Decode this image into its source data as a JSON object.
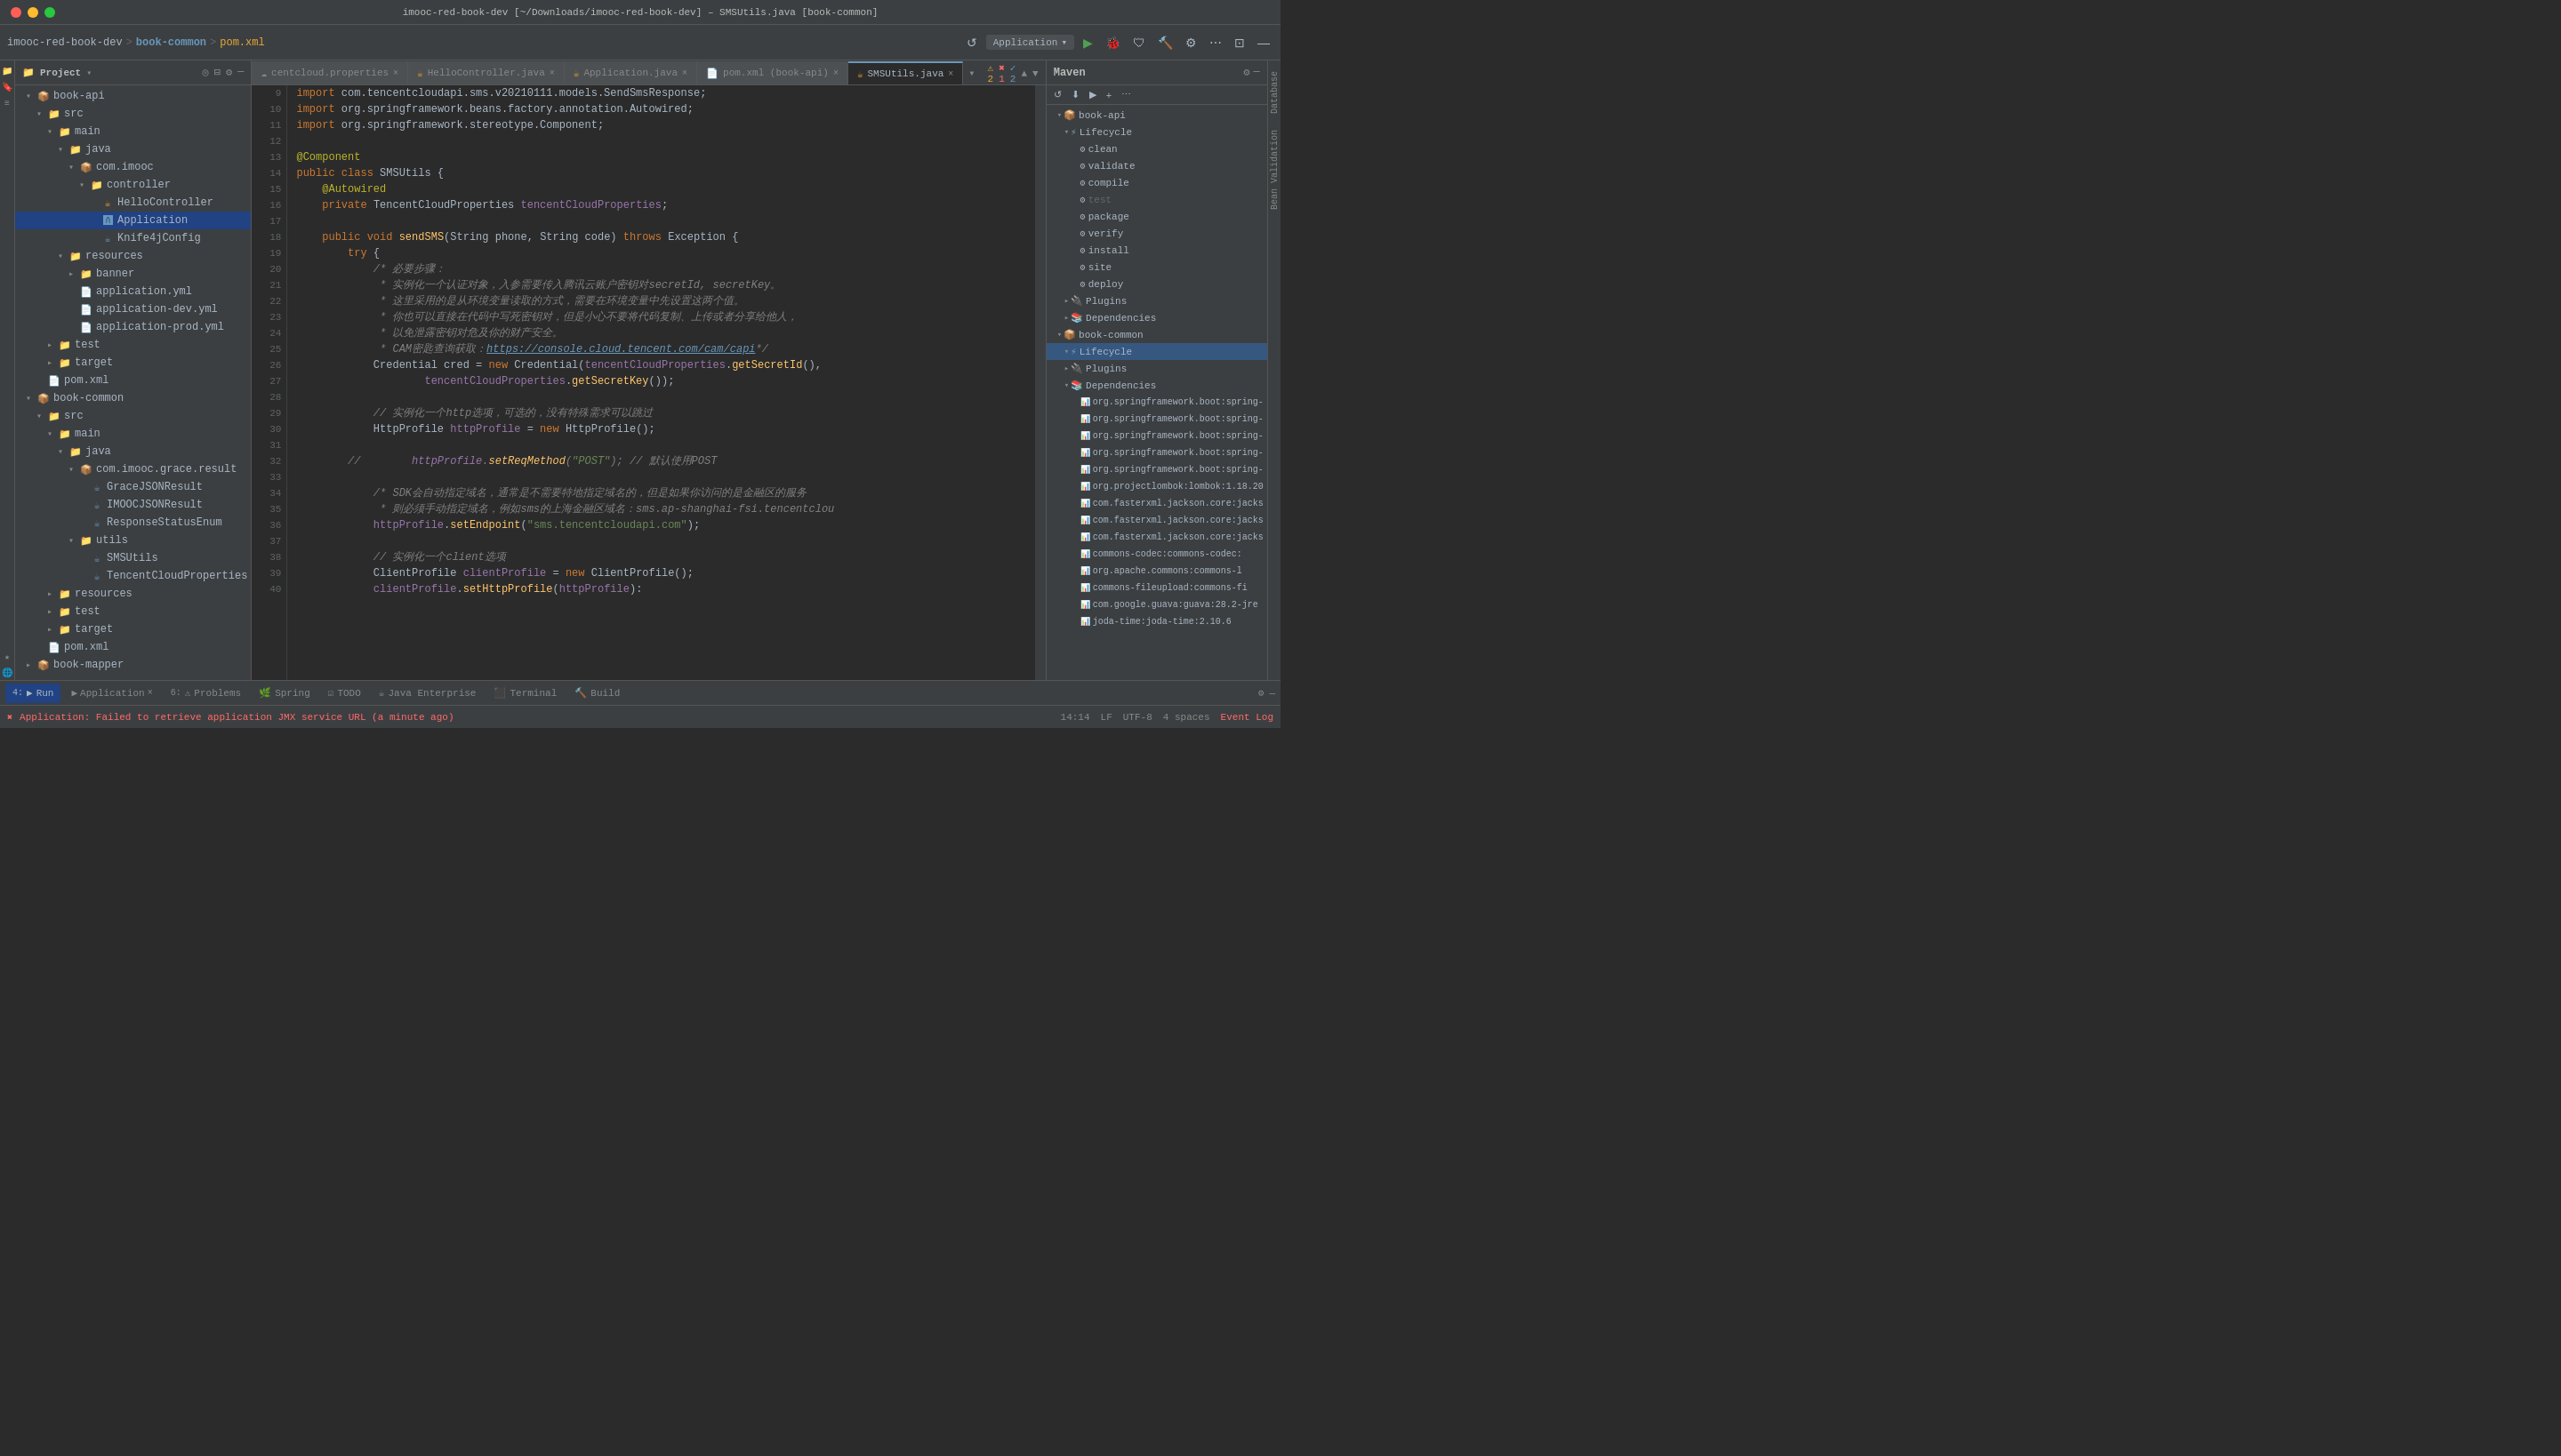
{
  "window": {
    "title": "imooc-red-book-dev [~/Downloads/imooc-red-book-dev] – SMSUtils.java [book-common]"
  },
  "breadcrumb": {
    "project": "imooc-red-book-dev",
    "sep1": ">",
    "module": "book-common",
    "sep2": ">",
    "file": "pom.xml"
  },
  "toolbar": {
    "run_config": "Application",
    "run_icon": "▶",
    "debug_icon": "🐛",
    "build_icon": "🔨",
    "refresh_icon": "↺",
    "settings_icon": "⚙",
    "run_green": "▶"
  },
  "project_panel": {
    "title": "Project",
    "items": [
      {
        "id": "book-api",
        "label": "book-api",
        "indent": 1,
        "type": "module",
        "expanded": true
      },
      {
        "id": "src1",
        "label": "src",
        "indent": 2,
        "type": "folder",
        "expanded": true
      },
      {
        "id": "main1",
        "label": "main",
        "indent": 3,
        "type": "folder",
        "expanded": true
      },
      {
        "id": "java1",
        "label": "java",
        "indent": 4,
        "type": "folder",
        "expanded": true
      },
      {
        "id": "comimooc1",
        "label": "com.imooc",
        "indent": 5,
        "type": "package",
        "expanded": true
      },
      {
        "id": "controller",
        "label": "controller",
        "indent": 6,
        "type": "folder",
        "expanded": true
      },
      {
        "id": "hellocontroller",
        "label": "HelloController",
        "indent": 7,
        "type": "java",
        "selected": false
      },
      {
        "id": "application",
        "label": "Application",
        "indent": 7,
        "type": "java",
        "selected": true
      },
      {
        "id": "knife4j",
        "label": "Knife4jConfig",
        "indent": 7,
        "type": "java",
        "selected": false
      },
      {
        "id": "resources1",
        "label": "resources",
        "indent": 4,
        "type": "folder",
        "expanded": true
      },
      {
        "id": "banner",
        "label": "banner",
        "indent": 5,
        "type": "folder",
        "expanded": false
      },
      {
        "id": "appyml",
        "label": "application.yml",
        "indent": 5,
        "type": "yaml"
      },
      {
        "id": "appdevyml",
        "label": "application-dev.yml",
        "indent": 5,
        "type": "yaml"
      },
      {
        "id": "appprodlyml",
        "label": "application-prod.yml",
        "indent": 5,
        "type": "yaml"
      },
      {
        "id": "test1",
        "label": "test",
        "indent": 3,
        "type": "folder",
        "expanded": false
      },
      {
        "id": "target1",
        "label": "target",
        "indent": 3,
        "type": "folder",
        "expanded": false
      },
      {
        "id": "pomxml1",
        "label": "pom.xml",
        "indent": 2,
        "type": "xml"
      },
      {
        "id": "book-common",
        "label": "book-common",
        "indent": 1,
        "type": "module",
        "expanded": true
      },
      {
        "id": "src2",
        "label": "src",
        "indent": 2,
        "type": "folder",
        "expanded": true
      },
      {
        "id": "main2",
        "label": "main",
        "indent": 3,
        "type": "folder",
        "expanded": true
      },
      {
        "id": "java2",
        "label": "java",
        "indent": 4,
        "type": "folder",
        "expanded": true
      },
      {
        "id": "comimoograce",
        "label": "com.imooc.grace.result",
        "indent": 5,
        "type": "package",
        "expanded": true
      },
      {
        "id": "gracejson",
        "label": "GraceJSONResult",
        "indent": 6,
        "type": "java"
      },
      {
        "id": "imoocjson",
        "label": "IMOOCJSONResult",
        "indent": 6,
        "type": "java"
      },
      {
        "id": "responsestatus",
        "label": "ResponseStatusEnum",
        "indent": 6,
        "type": "java"
      },
      {
        "id": "utils",
        "label": "utils",
        "indent": 5,
        "type": "folder",
        "expanded": true
      },
      {
        "id": "smsutils",
        "label": "SMSUtils",
        "indent": 6,
        "type": "java"
      },
      {
        "id": "tencentcloud",
        "label": "TencentCloudProperties",
        "indent": 6,
        "type": "java"
      },
      {
        "id": "resources2",
        "label": "resources",
        "indent": 3,
        "type": "folder",
        "expanded": false
      },
      {
        "id": "test2",
        "label": "test",
        "indent": 3,
        "type": "folder",
        "expanded": false
      },
      {
        "id": "target2",
        "label": "target",
        "indent": 3,
        "type": "folder",
        "expanded": false
      },
      {
        "id": "pomxml2",
        "label": "pom.xml",
        "indent": 2,
        "type": "xml"
      },
      {
        "id": "book-mapper",
        "label": "book-mapper",
        "indent": 1,
        "type": "module",
        "expanded": false
      }
    ]
  },
  "tabs": [
    {
      "id": "centcloud",
      "label": "centcloud.properties",
      "active": false,
      "icon": "☁"
    },
    {
      "id": "hellocontroller",
      "label": "HelloController.java",
      "active": false,
      "icon": "☕"
    },
    {
      "id": "applicationjava",
      "label": "Application.java",
      "active": false,
      "icon": "☕"
    },
    {
      "id": "pomapi",
      "label": "pom.xml (book-api)",
      "active": false,
      "icon": "📄"
    },
    {
      "id": "smsutils",
      "label": "SMSUtils.java",
      "active": true,
      "icon": "☕"
    }
  ],
  "editor": {
    "filename": "SMSUtils.java",
    "lines": [
      {
        "n": 9,
        "code": "import com.tencentcloudapi.sms.v20210111.models.SendSmsResponse;"
      },
      {
        "n": 10,
        "code": "import org.springframework.beans.factory.annotation.Autowired;"
      },
      {
        "n": 11,
        "code": "import org.springframework.stereotype.Component;"
      },
      {
        "n": 12,
        "code": ""
      },
      {
        "n": 13,
        "code": "@Component"
      },
      {
        "n": 14,
        "code": "public class SMSUtils {"
      },
      {
        "n": 15,
        "code": "    @Autowired"
      },
      {
        "n": 16,
        "code": "    private TencentCloudProperties tencentCloudProperties;"
      },
      {
        "n": 17,
        "code": ""
      },
      {
        "n": 18,
        "code": "    public void sendSMS(String phone, String code) throws Exception {"
      },
      {
        "n": 19,
        "code": "        try {"
      },
      {
        "n": 20,
        "code": "            /* 必要步骤："
      },
      {
        "n": 21,
        "code": "             * 实例化一个认证对象，入参需要传入腾讯云账户密钥对secretId, secretKey。"
      },
      {
        "n": 22,
        "code": "             * 这里采用的是从环境变量读取的方式，需要在环境变量中先设置这两个值。"
      },
      {
        "n": 23,
        "code": "             * 你也可以直接在代码中写死密钥对，但是小心不要将代码复制、上传或者分享给他人，"
      },
      {
        "n": 24,
        "code": "             * 以免泄露密钥对危及你的财产安全。"
      },
      {
        "n": 25,
        "code": "             * CAM密匙查询获取：https://console.cloud.tencent.com/cam/capi*/"
      },
      {
        "n": 26,
        "code": "            Credential cred = new Credential(tencentCloudProperties.getSecretId(),"
      },
      {
        "n": 27,
        "code": "                    tencentCloudProperties.getSecretKey());"
      },
      {
        "n": 28,
        "code": ""
      },
      {
        "n": 29,
        "code": "            // 实例化一个http选项，可选的，没有特殊需求可以跳过"
      },
      {
        "n": 30,
        "code": "            HttpProfile httpProfile = new HttpProfile();"
      },
      {
        "n": 31,
        "code": ""
      },
      {
        "n": 32,
        "code": "//            httpProfile.setReqMethod(\"POST\"); // 默认使用POST"
      },
      {
        "n": 33,
        "code": ""
      },
      {
        "n": 34,
        "code": "            /* SDK会自动指定域名，通常是不需要特地指定域名的，但是如果你访问的是金融区的服务"
      },
      {
        "n": 35,
        "code": "             * 则必须手动指定域名，例如sms的上海金融区域名：sms.ap-shanghai-fsi.tencentclou"
      },
      {
        "n": 36,
        "code": "            httpProfile.setEndpoint(\"sms.tencentcloudapi.com\");"
      },
      {
        "n": 37,
        "code": ""
      },
      {
        "n": 38,
        "code": "            // 实例化一个client选项"
      },
      {
        "n": 39,
        "code": "            ClientProfile clientProfile = new ClientProfile();"
      },
      {
        "n": 40,
        "code": "            clientProfile.setHttpProfile(httpProfile):"
      }
    ]
  },
  "maven": {
    "title": "Maven",
    "tree": [
      {
        "id": "book-api-root",
        "label": "book-api",
        "indent": 0,
        "type": "module",
        "expanded": true
      },
      {
        "id": "lifecycle-api",
        "label": "Lifecycle",
        "indent": 1,
        "type": "lifecycle",
        "expanded": true
      },
      {
        "id": "clean",
        "label": "clean",
        "indent": 2,
        "type": "goal"
      },
      {
        "id": "validate",
        "label": "validate",
        "indent": 2,
        "type": "goal"
      },
      {
        "id": "compile",
        "label": "compile",
        "indent": 2,
        "type": "goal"
      },
      {
        "id": "test-api",
        "label": "test",
        "indent": 2,
        "type": "goal",
        "muted": true
      },
      {
        "id": "package",
        "label": "package",
        "indent": 2,
        "type": "goal"
      },
      {
        "id": "verify",
        "label": "verify",
        "indent": 2,
        "type": "goal"
      },
      {
        "id": "install",
        "label": "install",
        "indent": 2,
        "type": "goal"
      },
      {
        "id": "site",
        "label": "site",
        "indent": 2,
        "type": "goal"
      },
      {
        "id": "deploy",
        "label": "deploy",
        "indent": 2,
        "type": "goal"
      },
      {
        "id": "plugins-api",
        "label": "Plugins",
        "indent": 1,
        "type": "plugins",
        "expanded": false
      },
      {
        "id": "deps-api",
        "label": "Dependencies",
        "indent": 1,
        "type": "deps",
        "expanded": false
      },
      {
        "id": "book-common-root",
        "label": "book-common",
        "indent": 0,
        "type": "module",
        "expanded": true
      },
      {
        "id": "lifecycle-common",
        "label": "Lifecycle",
        "indent": 1,
        "type": "lifecycle",
        "expanded": true,
        "selected": true
      },
      {
        "id": "plugins-common",
        "label": "Plugins",
        "indent": 1,
        "type": "plugins",
        "expanded": false
      },
      {
        "id": "deps-common",
        "label": "Dependencies",
        "indent": 1,
        "type": "deps",
        "expanded": true
      },
      {
        "id": "dep1",
        "label": "org.springframework.boot:spring-",
        "indent": 2,
        "type": "dep"
      },
      {
        "id": "dep2",
        "label": "org.springframework.boot:spring-",
        "indent": 2,
        "type": "dep"
      },
      {
        "id": "dep3",
        "label": "org.springframework.boot:spring-",
        "indent": 2,
        "type": "dep"
      },
      {
        "id": "dep4",
        "label": "org.springframework.boot:spring-",
        "indent": 2,
        "type": "dep"
      },
      {
        "id": "dep5",
        "label": "org.springframework.boot:spring-",
        "indent": 2,
        "type": "dep"
      },
      {
        "id": "dep6",
        "label": "org.projectlombok:lombok:1.18.20",
        "indent": 2,
        "type": "dep"
      },
      {
        "id": "dep7",
        "label": "com.fasterxml.jackson.core:jacks",
        "indent": 2,
        "type": "dep"
      },
      {
        "id": "dep8",
        "label": "com.fasterxml.jackson.core:jacks",
        "indent": 2,
        "type": "dep"
      },
      {
        "id": "dep9",
        "label": "com.fasterxml.jackson.core:jacks",
        "indent": 2,
        "type": "dep"
      },
      {
        "id": "dep10",
        "label": "commons-codec:commons-codec:",
        "indent": 2,
        "type": "dep"
      },
      {
        "id": "dep11",
        "label": "org.apache.commons:commons-l",
        "indent": 2,
        "type": "dep"
      },
      {
        "id": "dep12",
        "label": "commons-fileupload:commons-fi",
        "indent": 2,
        "type": "dep"
      },
      {
        "id": "dep13",
        "label": "com.google.guava:guava:28.2-jre",
        "indent": 2,
        "type": "dep"
      },
      {
        "id": "dep14",
        "label": "joda-time:joda-time:2.10.6",
        "indent": 2,
        "type": "dep"
      }
    ]
  },
  "bottom_tabs": [
    {
      "id": "run",
      "label": "Run",
      "icon": "▶",
      "badge": "4",
      "active": true
    },
    {
      "id": "problems",
      "label": "Problems",
      "icon": "⚠",
      "badge": "6",
      "active": false
    },
    {
      "id": "spring",
      "label": "Spring",
      "icon": "🌿",
      "active": false
    },
    {
      "id": "todo",
      "label": "TODO",
      "icon": "☑",
      "active": false
    },
    {
      "id": "enterprise",
      "label": "Java Enterprise",
      "icon": "☕",
      "active": false
    },
    {
      "id": "terminal",
      "label": "Terminal",
      "icon": "⬛",
      "active": false
    },
    {
      "id": "build",
      "label": "Build",
      "icon": "🔨",
      "active": false
    }
  ],
  "run_tab": {
    "label": "Application",
    "close": "×"
  },
  "status_bar": {
    "error_msg": "Application: Failed to retrieve application JMX service URL (a minute ago)",
    "position": "14:14",
    "line_sep": "LF",
    "encoding": "UTF-8",
    "indent": "4 spaces",
    "event_log": "Event Log"
  }
}
